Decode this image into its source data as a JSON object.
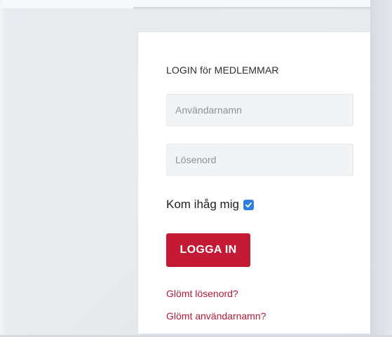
{
  "login": {
    "heading": "LOGIN för MEDLEMMAR",
    "username_placeholder": "Användarnamn",
    "password_placeholder": "Lösenord",
    "remember_label": "Kom ihåg mig",
    "remember_checked": true,
    "submit_label": "LOGGA IN",
    "forgot_password": "Glömt lösenord?",
    "forgot_username": "Glömt användarnamn?"
  },
  "colors": {
    "accent": "#c41a36",
    "link": "#b41a3a",
    "checkbox": "#2f7de1"
  }
}
